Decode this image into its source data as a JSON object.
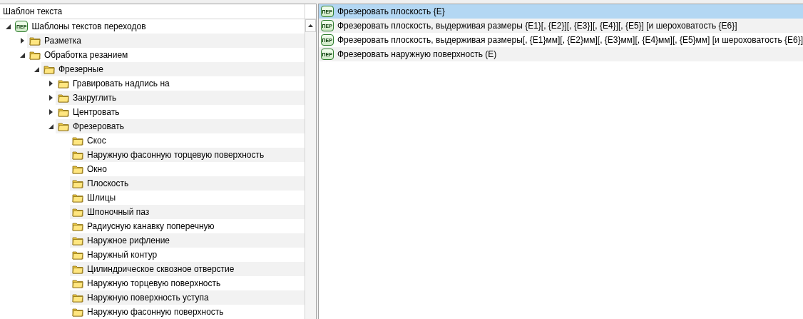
{
  "left_panel": {
    "header": "Шаблон текста",
    "tree": [
      {
        "label": "Шаблоны текстов переходов",
        "icon_label": "ПЕР",
        "expanded": true,
        "children": [
          {
            "label": "Разметка",
            "expanded": false
          },
          {
            "label": "Обработка резанием",
            "expanded": true,
            "children": [
              {
                "label": "Фрезерные",
                "expanded": true,
                "children": [
                  {
                    "label": "Гравировать надпись на",
                    "expanded": false
                  },
                  {
                    "label": "Закруглить",
                    "expanded": false
                  },
                  {
                    "label": "Центровать",
                    "expanded": false
                  },
                  {
                    "label": "Фрезеровать",
                    "expanded": true,
                    "children": [
                      {
                        "label": "Скос"
                      },
                      {
                        "label": "Наружную фасонную торцевую поверхность"
                      },
                      {
                        "label": "Окно"
                      },
                      {
                        "label": "Плоскость"
                      },
                      {
                        "label": "Шлицы"
                      },
                      {
                        "label": "Шпоночный паз"
                      },
                      {
                        "label": "Радиусную канавку поперечную"
                      },
                      {
                        "label": "Наружное рифление"
                      },
                      {
                        "label": "Наружный контур"
                      },
                      {
                        "label": "Цилиндрическое сквозное отверстие"
                      },
                      {
                        "label": "Наружную торцевую поверхность"
                      },
                      {
                        "label": "Наружную поверхность уступа"
                      },
                      {
                        "label": "Наружную фасонную поверхность"
                      }
                    ]
                  }
                ]
              }
            ]
          }
        ]
      }
    ]
  },
  "right_panel": {
    "rows": [
      {
        "icon_label": "ПЕР",
        "text": "Фрезеровать плоскость {E}",
        "selected": true
      },
      {
        "icon_label": "ПЕР",
        "text": "Фрезеровать плоскость, выдерживая размеры {E1}[, {E2}][, {E3}][, {E4}][, {E5}] [и шероховатость {E6}]",
        "selected": false
      },
      {
        "icon_label": "ПЕР",
        "text": "Фрезеровать плоскость, выдерживая размеры[, {E1}мм][, {E2}мм][, {E3}мм][, {E4}мм][, {E5}мм] [и шероховатость {E6}]",
        "selected": false
      },
      {
        "icon_label": "ПЕР",
        "text": "Фрезеровать наружную поверхность (E)",
        "selected": false
      }
    ]
  }
}
